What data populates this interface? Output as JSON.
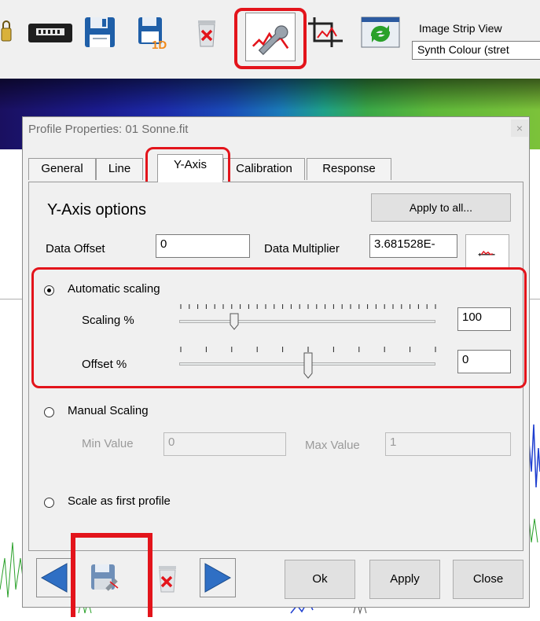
{
  "toolbar": {
    "image_strip_label": "Image Strip View",
    "image_strip_value": "Synth Colour (stret"
  },
  "dialog": {
    "title": "Profile Properties: 01 Sonne.fit",
    "close_label": "×",
    "tabs": [
      {
        "label": "General",
        "active": false
      },
      {
        "label": "Line",
        "active": false
      },
      {
        "label": "Y-Axis",
        "active": true
      },
      {
        "label": "Calibration",
        "active": false
      },
      {
        "label": "Response",
        "active": false
      }
    ],
    "y_axis": {
      "section_title": "Y-Axis options",
      "apply_to_all_label": "Apply to all...",
      "data_offset_label": "Data Offset",
      "data_offset_value": "0",
      "data_multiplier_label": "Data Multiplier",
      "data_multiplier_value": "3.681528E-",
      "automatic_scaling_label": "Automatic scaling",
      "automatic_scaling_checked": true,
      "scaling_label": "Scaling %",
      "scaling_value": "100",
      "offset_label": "Offset %",
      "offset_value": "0",
      "manual_scaling_label": "Manual Scaling",
      "manual_scaling_checked": false,
      "min_value_label": "Min Value",
      "min_value": "0",
      "max_value_label": "Max Value",
      "max_value": "1",
      "scale_first_label": "Scale as first profile",
      "scale_first_checked": false
    },
    "buttons": {
      "ok": "Ok",
      "apply": "Apply",
      "close": "Close"
    }
  },
  "colors": {
    "highlight": "#e3141b",
    "dialog_bg": "#f0f0f0"
  },
  "icons": [
    "lock-icon",
    "camera-icon",
    "save-icon",
    "save-1d-icon",
    "delete-icon",
    "profile-properties-icon",
    "crop-icon",
    "refresh-icon",
    "profile-graph-icon",
    "prev-arrow-icon",
    "save-profile-icon",
    "delete-profile-icon",
    "next-arrow-icon"
  ]
}
